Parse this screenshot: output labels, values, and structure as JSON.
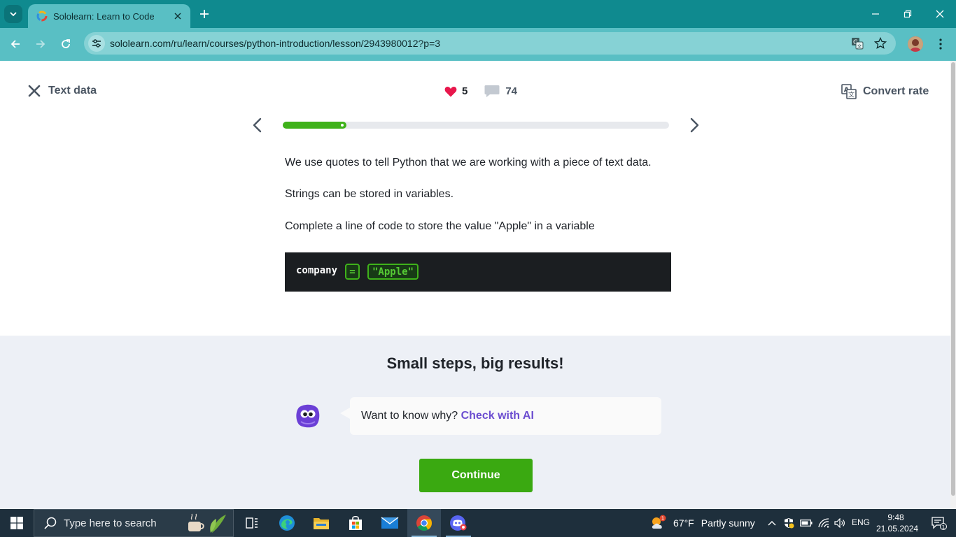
{
  "browser": {
    "tab_title": "Sololearn: Learn to Code",
    "url": "sololearn.com/ru/learn/courses/python-introduction/lesson/2943980012?p=3",
    "accent_color": "#0f8a8f"
  },
  "lesson": {
    "title": "Text data",
    "likes": "5",
    "comments": "74",
    "translate_label": "Convert rate",
    "progress": 0.165,
    "paragraphs": [
      "We use quotes to tell Python that we are working with a piece of text data.",
      "Strings can be stored in variables.",
      "Complete a line of code to store the value \"Apple\" in a variable"
    ],
    "code": {
      "variable": "company",
      "slot_operator": "=",
      "slot_value": "\"Apple\""
    }
  },
  "bottom": {
    "headline": "Small steps, big results!",
    "ai_prompt": "Want to know why?",
    "ai_link": "Check with AI",
    "continue_label": "Continue"
  },
  "taskbar": {
    "search_placeholder": "Type here to search",
    "weather_temp": "67°F",
    "weather_desc": "Partly sunny",
    "weather_badge": "1",
    "language": "ENG",
    "time": "9:48",
    "date": "21.05.2024",
    "notification_count": "1"
  }
}
